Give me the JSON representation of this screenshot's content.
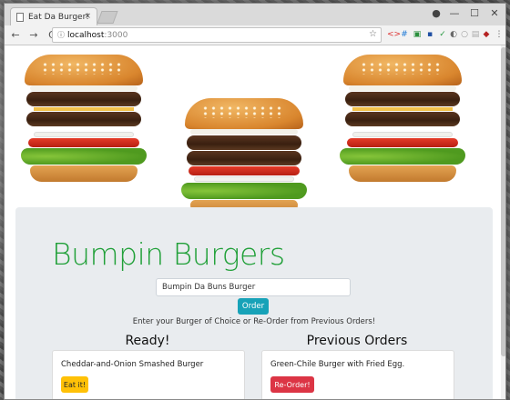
{
  "browser": {
    "tab_title": "Eat Da Burger!",
    "tab_close": "×",
    "url_host": "localhost",
    "url_port": ":3000",
    "nav": {
      "back": "←",
      "forward": "→",
      "reload": "C"
    },
    "window_controls": {
      "user": "●",
      "minimize": "—",
      "maximize": "☐",
      "close": "✕"
    },
    "extensions": [
      "☆",
      "<>",
      "#",
      "▣",
      "▪",
      "✓",
      "◐",
      "○",
      "▤",
      "◆",
      "⋮"
    ]
  },
  "app": {
    "title": "Bumpin Burgers",
    "input_value": "Bumpin Da Buns Burger",
    "order_label": "Order",
    "hint": "Enter your Burger of Choice or Re-Order from Previous Orders!"
  },
  "ready": {
    "heading": "Ready!",
    "items": [
      {
        "name": "Cheddar-and-Onion Smashed Burger",
        "button": "Eat it!"
      }
    ]
  },
  "previous": {
    "heading": "Previous Orders",
    "items": [
      {
        "name": "Green-Chile Burger with Fried Egg.",
        "button": "Re-Order!"
      }
    ]
  },
  "colors": {
    "brand": "#21a039",
    "order_button": "#17a2b8",
    "eat_button": "#ffc107",
    "reorder_button": "#dc3545"
  }
}
